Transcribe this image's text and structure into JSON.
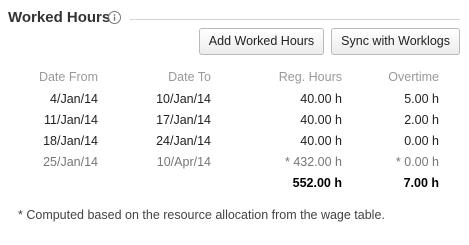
{
  "header": {
    "title": "Worked Hours"
  },
  "toolbar": {
    "add_label": "Add Worked Hours",
    "sync_label": "Sync with Worklogs"
  },
  "table": {
    "columns": [
      "Date From",
      "Date To",
      "Reg. Hours",
      "Overtime"
    ],
    "rows": [
      {
        "from": "4/Jan/14",
        "to": "10/Jan/14",
        "reg": "40.00 h",
        "ot": "5.00 h"
      },
      {
        "from": "11/Jan/14",
        "to": "17/Jan/14",
        "reg": "40.00 h",
        "ot": "2.00 h"
      },
      {
        "from": "18/Jan/14",
        "to": "24/Jan/14",
        "reg": "40.00 h",
        "ot": "0.00 h"
      },
      {
        "from": "25/Jan/14",
        "to": "10/Apr/14",
        "reg": "* 432.00 h",
        "ot": "* 0.00 h"
      }
    ],
    "totals": {
      "reg": "552.00 h",
      "ot": "7.00 h"
    }
  },
  "footnote": "* Computed based on the resource allocation from the wage table.",
  "colors": {
    "header_text": "#999999",
    "computed_text": "#777777",
    "button_border": "#b9b9b9"
  },
  "icons": [
    "info-icon"
  ]
}
